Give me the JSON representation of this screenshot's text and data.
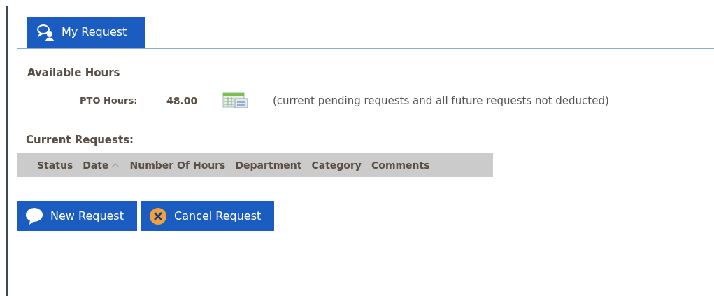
{
  "tabs": [
    {
      "label": "My Request",
      "selected": true
    }
  ],
  "available_hours": {
    "title": "Available Hours",
    "label": "PTO Hours:",
    "value": "48.00",
    "note": "(current pending requests and all future requests not deducted)"
  },
  "current_requests": {
    "title": "Current Requests:",
    "columns": [
      {
        "label": "Status",
        "sorted": false
      },
      {
        "label": "Date",
        "sorted": true
      },
      {
        "label": "Number Of Hours",
        "sorted": false
      },
      {
        "label": "Department",
        "sorted": false
      },
      {
        "label": "Category",
        "sorted": false
      },
      {
        "label": "Comments",
        "sorted": false
      }
    ]
  },
  "buttons": [
    {
      "label": "New Request",
      "kind": "new"
    },
    {
      "label": "Cancel Request",
      "kind": "cancel"
    }
  ]
}
